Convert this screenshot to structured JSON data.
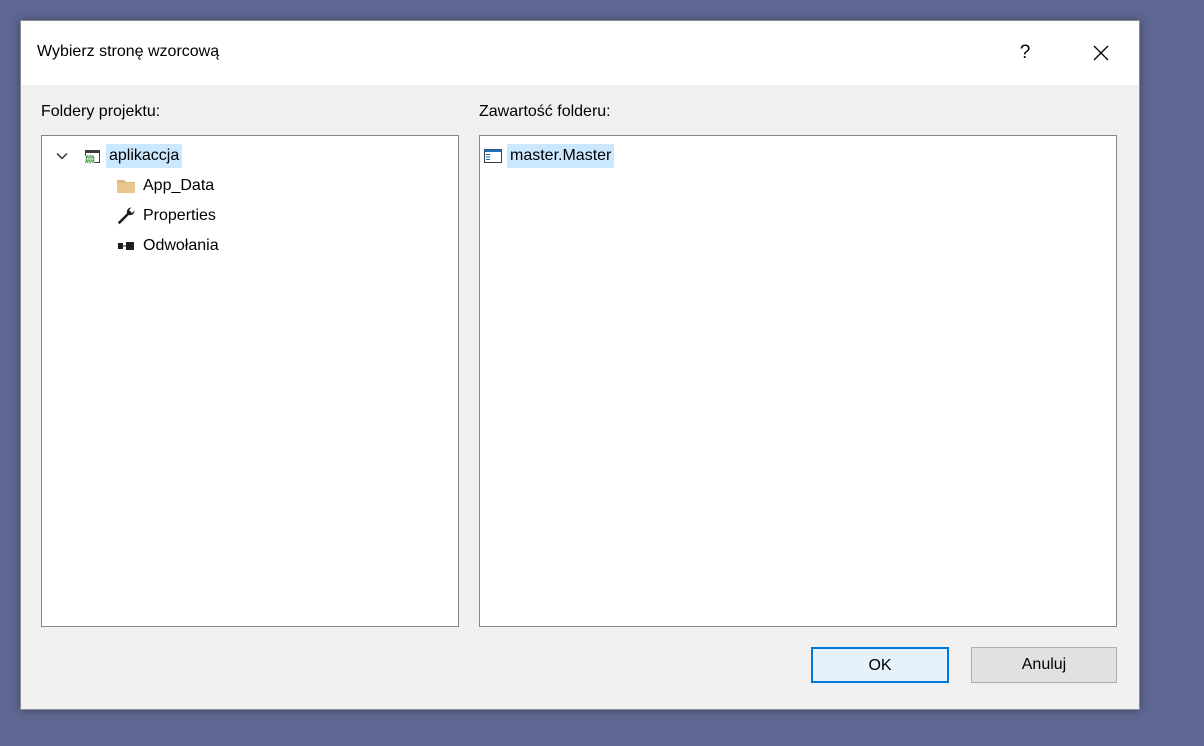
{
  "dialog": {
    "title": "Wybierz stronę wzorcową",
    "help_label": "?"
  },
  "left_panel": {
    "label": "Foldery projektu:",
    "tree": [
      {
        "label": "aplikaccja",
        "icon": "web-project-icon",
        "expanded": true,
        "selected": true
      },
      {
        "label": "App_Data",
        "icon": "folder-icon"
      },
      {
        "label": "Properties",
        "icon": "wrench-icon"
      },
      {
        "label": "Odwołania",
        "icon": "references-icon"
      }
    ]
  },
  "right_panel": {
    "label": "Zawartość folderu:",
    "items": [
      {
        "label": "master.Master",
        "icon": "master-page-icon",
        "selected": true
      }
    ]
  },
  "buttons": {
    "ok_label": "OK",
    "cancel_label": "Anuluj"
  },
  "colors": {
    "desktop": "#5d6791",
    "dialog_bg": "#f0f0f0",
    "selection": "#cce8ff",
    "accent": "#0078d7"
  }
}
